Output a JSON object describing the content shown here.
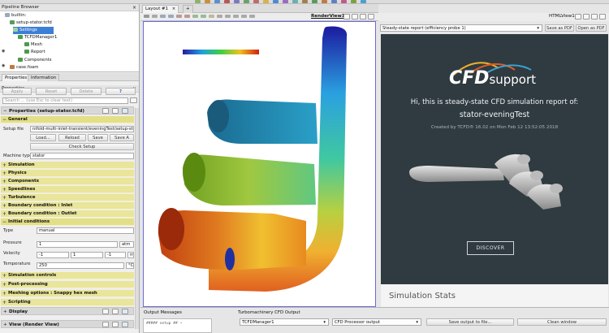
{
  "pipeline_browser": {
    "title": "Pipeline Browser",
    "items": [
      {
        "label": "builtin:"
      },
      {
        "label": "setup-stator.tcfd"
      },
      {
        "label": "Settings"
      },
      {
        "label": "TCFDManager1"
      },
      {
        "label": "Mesh"
      },
      {
        "label": "Report"
      },
      {
        "label": "Components"
      },
      {
        "label": "case.foam"
      }
    ]
  },
  "properties_panel": {
    "title": "Properties",
    "tabs": [
      "Properties",
      "Information"
    ],
    "apply_label": "Apply",
    "reset_label": "Reset",
    "delete_label": "Delete",
    "help_label": "?",
    "search_placeholder": "Search ... (use Esc to clear text)",
    "group_title": "Properties (setup-stator.tcfd)",
    "general_label": "General",
    "setup_file_label": "Setup file",
    "setup_file_value": "nifold-multi-inlet-transient/eveningTest/setup-stator.t",
    "load_label": "Load...",
    "reload_label": "Reload",
    "save_label": "Save",
    "save_as_label": "Save A",
    "check_setup_label": "Check Setup",
    "machine_type_label": "Machine type",
    "machine_type_value": "stator",
    "sections_a": [
      "Simulation",
      "Physics",
      "Components",
      "Speedlines",
      "Turbulence",
      "Boundary condition : Inlet",
      "Boundary condition : Outlet"
    ],
    "initial_conditions_label": "Initial conditions",
    "type_label": "Type",
    "type_value": "manual",
    "pressure_label": "Pressure",
    "pressure_value": "1",
    "pressure_unit": "atm",
    "velocity_label": "Velocity",
    "velocity_values": [
      "-1",
      "1",
      "-1"
    ],
    "velocity_unit": "m",
    "temperature_label": "Temperature",
    "temperature_value": "250",
    "temperature_unit": "°C",
    "sections_b": [
      "Simulation controls",
      "Post-processing",
      "Meshing options : Snappy hex mesh",
      "Scripting"
    ],
    "display_label": "Display",
    "view_label": "View (Render View)"
  },
  "layout": {
    "tab_label": "Layout #1",
    "add_tab": "+",
    "render_view_label": "RenderView1",
    "html_view_label": "HTMLView1"
  },
  "html_view": {
    "report_select": "Steady-state report (efficiency probe 1)",
    "save_pdf_label": "Save as PDF",
    "open_pdf_label": "Open as PDF",
    "logo_text": "CFD",
    "logo_sub": "support",
    "heading_line1": "Hi, this is steady-state CFD simulation report of:",
    "heading_line2": "stator-eveningTest",
    "created_by": "Created by TCFD® 16.02 on Mon Feb 12 13:52:05 2018",
    "discover_label": "DISCOVER",
    "stats_label": "Simulation Stats"
  },
  "bottom": {
    "output_messages_label": "Output Messages",
    "message_preview": "##### setup ## ~",
    "turbo_output_label": "Turbomachinery CFD Output",
    "manager_select": "TCFDManager1",
    "processor_select": "CFD Processor output",
    "save_output_label": "Save output to file...",
    "clean_window_label": "Clean window"
  },
  "colors": {
    "accent": "#3d7fd6",
    "section_yellow": "#e9e59a",
    "render_border": "#6b6bd8",
    "report_bg": "#2f3b41"
  }
}
